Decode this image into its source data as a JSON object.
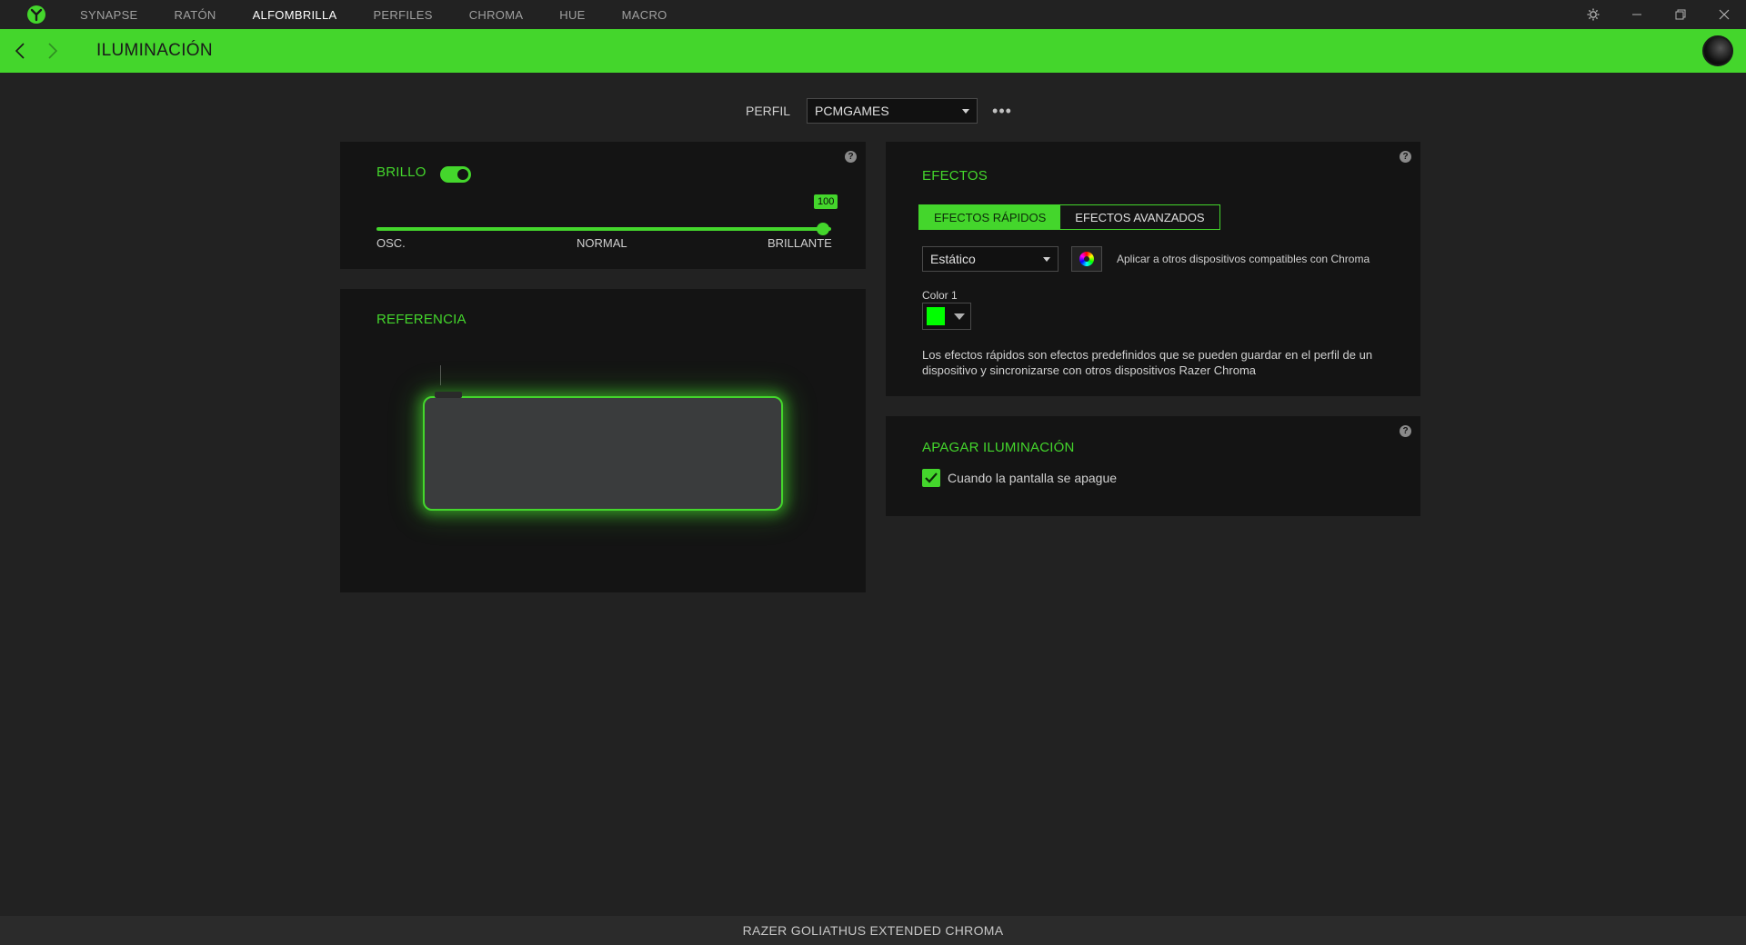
{
  "nav": {
    "items": [
      "SYNAPSE",
      "RATÓN",
      "ALFOMBRILLA",
      "PERFILES",
      "CHROMA",
      "HUE",
      "MACRO"
    ],
    "active_index": 2
  },
  "header": {
    "title": "ILUMINACIÓN"
  },
  "profile": {
    "label": "PERFIL",
    "selected": "PCMGAMES"
  },
  "brightness": {
    "title": "BRILLO",
    "enabled": true,
    "value": "100",
    "labels": {
      "low": "OSC.",
      "mid": "NORMAL",
      "high": "BRILLANTE"
    }
  },
  "reference": {
    "title": "REFERENCIA"
  },
  "effects": {
    "title": "EFECTOS",
    "tabs": [
      "EFECTOS RÁPIDOS",
      "EFECTOS AVANZADOS"
    ],
    "active_tab": 0,
    "effect_selected": "Estático",
    "apply_text": "Aplicar a otros dispositivos compatibles con Chroma",
    "color_label": "Color 1",
    "color_value": "#00ff00",
    "description": "Los efectos rápidos son efectos predefinidos que se pueden guardar en el perfil de un dispositivo y sincronizarse con otros dispositivos Razer Chroma"
  },
  "lights_off": {
    "title": "APAGAR ILUMINACIÓN",
    "checkbox_label": "Cuando la pantalla se apague",
    "checked": true
  },
  "footer": {
    "device_name": "RAZER GOLIATHUS EXTENDED CHROMA"
  },
  "colors": {
    "accent": "#44d62c",
    "background": "#222222",
    "panel": "#141414"
  }
}
